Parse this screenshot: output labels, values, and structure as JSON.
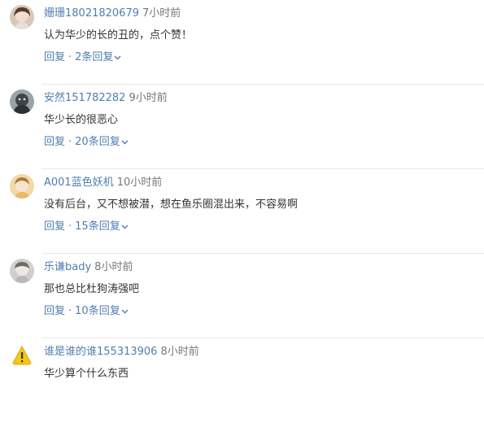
{
  "comments": [
    {
      "username": "姗珊18021820679",
      "time": "7小时前",
      "text": "认为华少的长的丑的，点个赞！",
      "reply_label": "回复",
      "separator": "·",
      "replies_label": "2条回复",
      "avatar_icon": "avatar-girl-icon"
    },
    {
      "username": "安然151782282",
      "time": "9小时前",
      "text": "华少长的很恶心",
      "reply_label": "回复",
      "separator": "·",
      "replies_label": "20条回复",
      "avatar_icon": "avatar-dark-icon"
    },
    {
      "username": "A001蓝色妖机",
      "time": "10小时前",
      "text": "没有后台，又不想被潜，想在鱼乐圈混出来，不容易啊",
      "reply_label": "回复",
      "separator": "·",
      "replies_label": "15条回复",
      "avatar_icon": "avatar-warm-icon"
    },
    {
      "username": "乐谦bady",
      "time": "8小时前",
      "text": "那也总比杜狗涛强吧",
      "reply_label": "回复",
      "separator": "·",
      "replies_label": "10条回复",
      "avatar_icon": "avatar-grey-icon"
    },
    {
      "username": "谁是谁的谁155313906",
      "time": "8小时前",
      "text": "华少算个什么东西",
      "reply_label": "回复",
      "separator": "·",
      "replies_label": "",
      "avatar_icon": "avatar-warning-icon"
    }
  ],
  "colors": {
    "username": "#507daf",
    "time": "#777777",
    "text": "#333333",
    "action": "#507daf",
    "divider": "#e8e8e8"
  }
}
